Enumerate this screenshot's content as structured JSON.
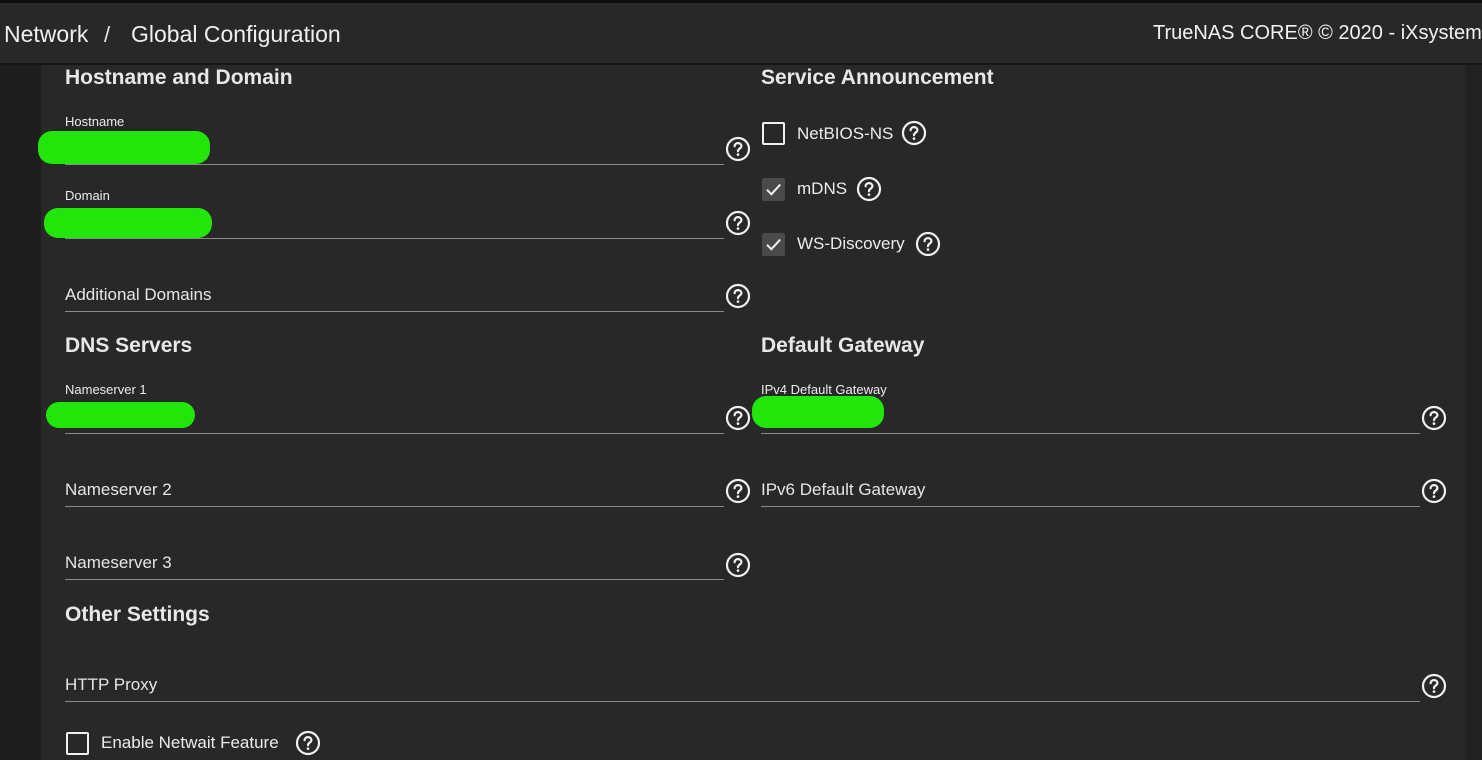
{
  "header": {
    "breadcrumb_parent": "Network",
    "breadcrumb_separator": "/",
    "breadcrumb_current": "Global Configuration",
    "copyright": "TrueNAS CORE® © 2020 - iXsystem"
  },
  "hostname_domain": {
    "title": "Hostname and Domain",
    "hostname_label": "Hostname",
    "hostname_value": "",
    "domain_label": "Domain",
    "domain_value": "",
    "additional_domains_placeholder": "Additional Domains"
  },
  "service_announcement": {
    "title": "Service Announcement",
    "items": [
      {
        "label": "NetBIOS-NS",
        "checked": false
      },
      {
        "label": "mDNS",
        "checked": true
      },
      {
        "label": "WS-Discovery",
        "checked": true
      }
    ]
  },
  "dns_servers": {
    "title": "DNS Servers",
    "nameserver1_label": "Nameserver 1",
    "nameserver1_value": "",
    "nameserver2_placeholder": "Nameserver 2",
    "nameserver3_placeholder": "Nameserver 3"
  },
  "default_gateway": {
    "title": "Default Gateway",
    "ipv4_label": "IPv4 Default Gateway",
    "ipv4_value": "",
    "ipv6_placeholder": "IPv6 Default Gateway"
  },
  "other_settings": {
    "title": "Other Settings",
    "http_proxy_placeholder": "HTTP Proxy",
    "netwait_label": "Enable Netwait Feature",
    "netwait_checked": false
  },
  "colors": {
    "background": "#222222",
    "card": "#282828",
    "redaction": "#22e60a",
    "text": "#ebebeb"
  },
  "icons": {
    "help": "help-circle-icon",
    "check": "check-icon"
  }
}
